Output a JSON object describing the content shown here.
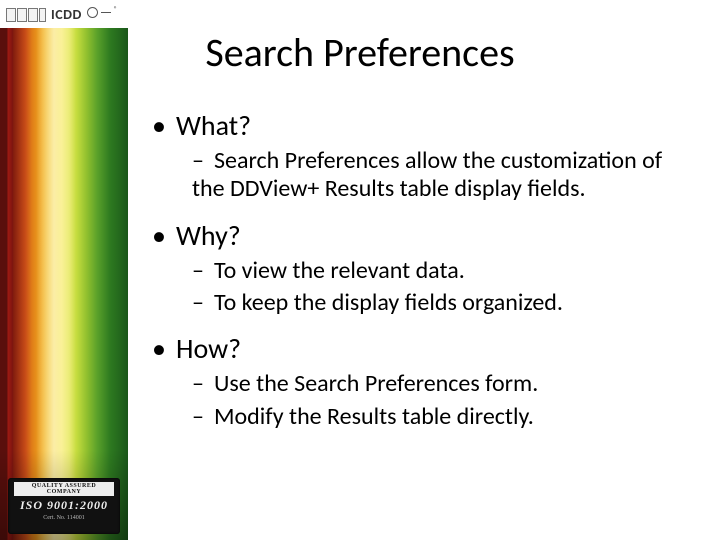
{
  "logo": {
    "name": "ICDD",
    "reg": "®"
  },
  "badge": {
    "top": "QUALITY ASSURED COMPANY",
    "line": "ISO 9001:2000",
    "cert": "Cert. No. 114001"
  },
  "title": "Search Preferences",
  "content": {
    "what_heading": "What?",
    "what_1": "Search Preferences allow the customization of the DDView+ Results table display fields.",
    "why_heading": "Why?",
    "why_1": "To view the relevant data.",
    "why_2": "To keep the display fields organized.",
    "how_heading": "How?",
    "how_1": "Use the Search Preferences form.",
    "how_2": "Modify the Results table directly."
  }
}
